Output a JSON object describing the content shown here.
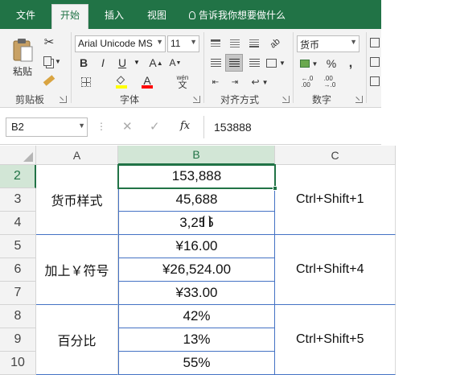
{
  "ribbon": {
    "tabs": [
      "文件",
      "开始",
      "插入",
      "视图"
    ],
    "active_tab": "开始",
    "tell_me": "告诉我你想要做什么",
    "clipboard": {
      "paste_label": "粘贴",
      "group": "剪贴板"
    },
    "font": {
      "name": "Arial Unicode MS",
      "size": "11",
      "bold": "B",
      "italic": "I",
      "underline": "U",
      "grow": "A",
      "shrink": "A",
      "color_letter": "A",
      "pinyin": "wén",
      "group": "字体"
    },
    "alignment": {
      "group": "对齐方式"
    },
    "number": {
      "format": "货币",
      "percent": "%",
      "comma": ",",
      "group": "数字"
    },
    "colors": {
      "accent": "#217346",
      "font_color": "#ff0000",
      "fill_color": "#ffff00"
    }
  },
  "formula_bar": {
    "name_box": "B2",
    "fx": "fx",
    "value": "153888"
  },
  "grid": {
    "columns": [
      "A",
      "B",
      "C"
    ],
    "rows": [
      "2",
      "3",
      "4",
      "5",
      "6",
      "7",
      "8",
      "9",
      "10"
    ],
    "b_values": [
      "153,888",
      "45,688",
      "3,255",
      "¥16.00",
      "¥26,524.00",
      "¥33.00",
      "42%",
      "13%",
      "55%"
    ],
    "groups": [
      {
        "a": "货币样式",
        "c": "Ctrl+Shift+1"
      },
      {
        "a": "加上￥符号",
        "c": "Ctrl+Shift+4"
      },
      {
        "a": "百分比",
        "c": "Ctrl+Shift+5"
      }
    ],
    "selected": "B2"
  }
}
